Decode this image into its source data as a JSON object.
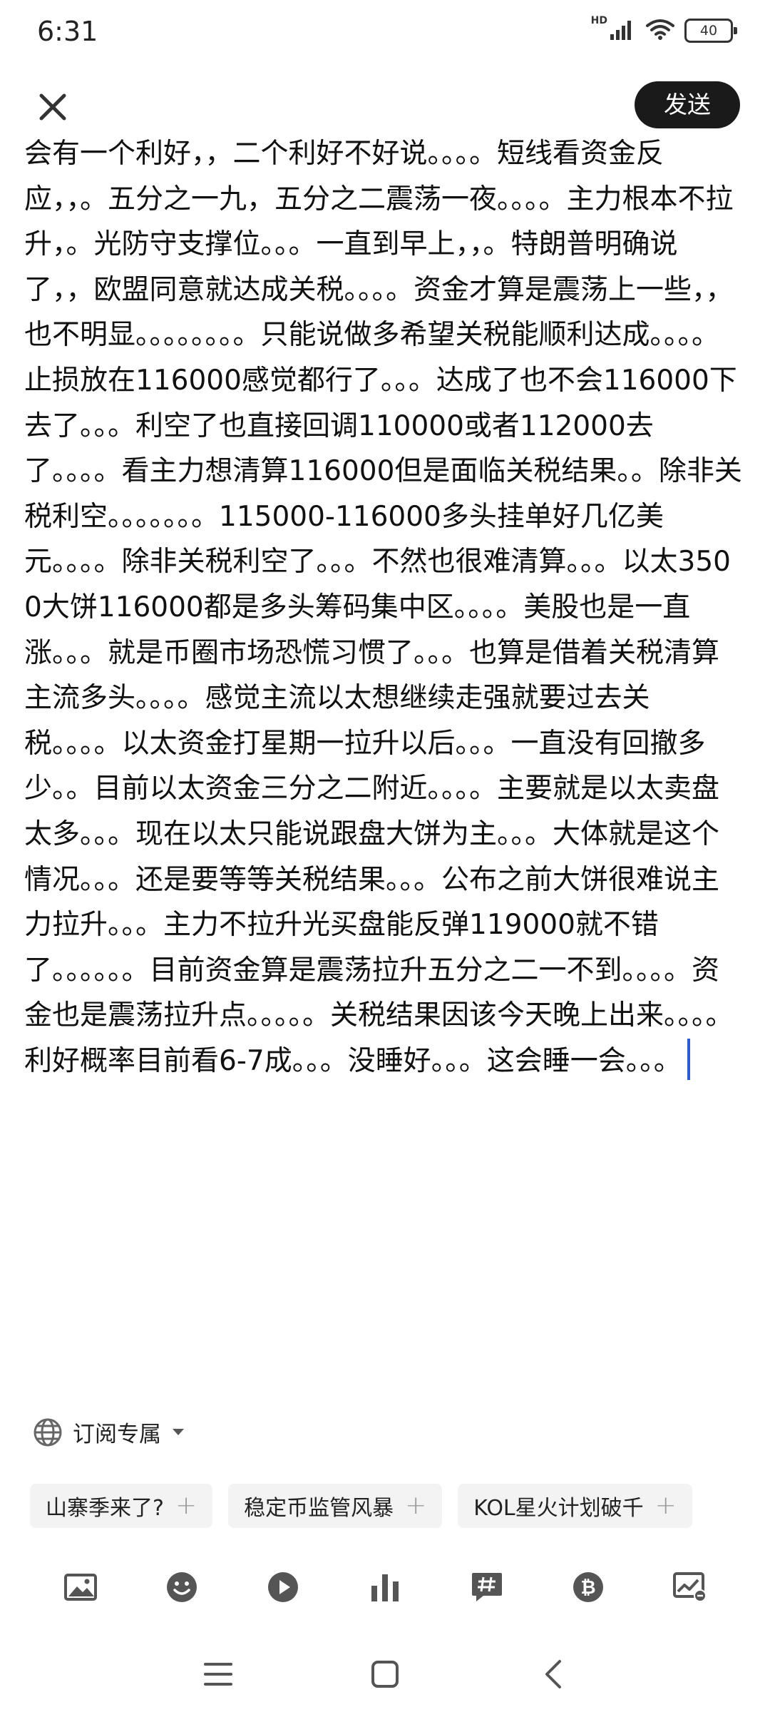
{
  "status_bar": {
    "time": "6:31",
    "network_label": "HD",
    "battery": "40"
  },
  "header": {
    "send_label": "发送"
  },
  "editor": {
    "content": "会有一个利好，，二个利好不好说。。。。短线看资金反应，，。五分之一九，五分之二震荡一夜。。。。主力根本不拉升，。光防守支撑位。。。一直到早上，，。特朗普明确说了，，欧盟同意就达成关税。。。。资金才算是震荡上一些，，也不明显。。。。。。。。只能说做多希望关税能顺利达成。。。。止损放在116000感觉都行了。。。达成了也不会116000下去了。。。利空了也直接回调110000或者112000去了。。。。看主力想清算116000但是面临关税结果。。除非关税利空。。。。。。。115000-116000多头挂单好几亿美元。。。。除非关税利空了。。。不然也很难清算。。。以太3500大饼116000都是多头筹码集中区。。。。美股也是一直涨。。。就是币圈市场恐慌习惯了。。。也算是借着关税清算主流多头。。。。感觉主流以太想继续走强就要过去关税。。。。以太资金打星期一拉升以后。。。一直没有回撤多少。。目前以太资金三分之二附近。。。。主要就是以太卖盘太多。。。现在以太只能说跟盘大饼为主。。。大体就是这个情况。。。还是要等等关税结果。。。公布之前大饼很难说主力拉升。。。主力不拉升光买盘能反弹119000就不错了。。。。。。目前资金算是震荡拉升五分之二一不到。。。。资金也是震荡拉升点。。。。。关税结果因该今天晚上出来。。。。利好概率目前看6-7成。。。没睡好。。。这会睡一会。。。"
  },
  "visibility": {
    "label": "订阅专属"
  },
  "topics": [
    {
      "label": "山寨季来了?"
    },
    {
      "label": "稳定币监管风暴"
    },
    {
      "label": "KOL星火计划破千"
    }
  ],
  "toolbar": {
    "icons": [
      "image-icon",
      "emoji-icon",
      "video-icon",
      "poll-icon",
      "hashtag-icon",
      "bitcoin-icon",
      "chart-icon"
    ]
  },
  "colors": {
    "send_button_bg": "#1a1a1a",
    "caret": "#2a5bd7",
    "chip_bg": "#f3f3f3",
    "icon": "#555555"
  }
}
